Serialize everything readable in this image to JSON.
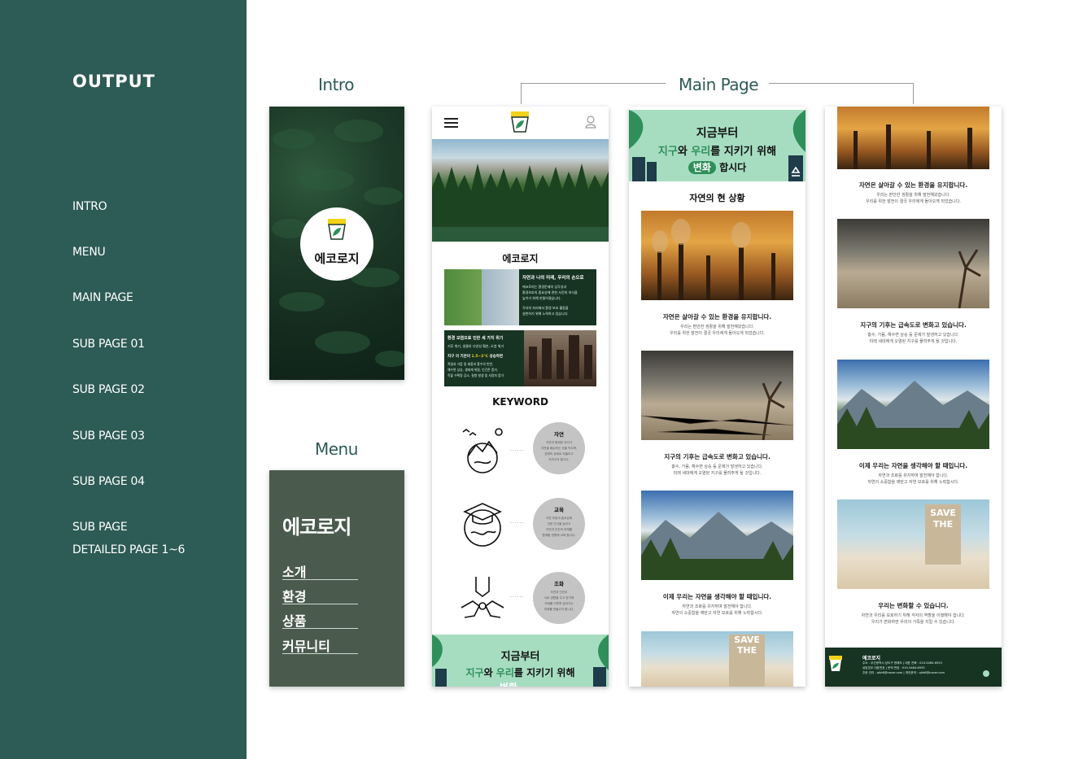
{
  "sidebar": {
    "title": "OUTPUT",
    "items": [
      "INTRO",
      "MENU",
      "MAIN PAGE",
      "SUB PAGE 01",
      "SUB PAGE 02",
      "SUB PAGE 03",
      "SUB PAGE 04"
    ],
    "last_item_line1": "SUB PAGE",
    "last_item_line2": "DETAILED PAGE 1~6"
  },
  "labels": {
    "intro": "Intro",
    "menu": "Menu",
    "main_page": "Main Page"
  },
  "intro": {
    "logo_text": "에코로지",
    "logo_mark": "에코로지"
  },
  "menu_panel": {
    "brand": "에코로지",
    "items": [
      "소개",
      "환경",
      "상품",
      "커뮤니티"
    ]
  },
  "main": {
    "logo_mark": "에코로지",
    "section_title": "에코로지",
    "card1_title": "자연과 나의 미래, 우리의 손으로",
    "card1_text1": "에코로지는 환경문제의 심각성과",
    "card1_text2": "환경보호의 중요성에 관한 사진의 의식을",
    "card1_text3": "높이기 위해 만들어졌습니다.",
    "card1_text4": "각자의 자리에서 환경 보호 활동을",
    "card1_text5": "실천하기 위해 노력하고 있습니다.",
    "card2_title": "환경 오염으로 인한 세 가지 위기",
    "card2_text1": "기후 위기, 생물의 다양성 훼손, 오염 위기",
    "card2_text2_a": "지구 의 기온이 ",
    "card2_text2_b": "1.5~2℃",
    "card2_text2_c": " 상승하면",
    "card2_text3": "폭염과 가뭄 및 태풍과 홍수의 빈번,",
    "card2_text4": "해수면 상승, 생태계 위협, 인간존 증가,",
    "card2_text5": "작물 수확량 감소, 질병 발생 및 사망자 증가",
    "keyword_title": "KEYWORD",
    "keywords": [
      {
        "title": "자연",
        "l1": "자연과 함께한 우리가",
        "l2": "자연을 훼손하는 것을 막으며,",
        "l3": "본래의 상태로 되돌리고",
        "l4": "지켜고자 합니다."
      },
      {
        "title": "교육",
        "l1": "자연 보호의 중요성에",
        "l2": "관한 인식을 높이고",
        "l3": "자연과 인간의 미래를",
        "l4": "함께할 방향에 교육 합니다."
      },
      {
        "title": "조화",
        "l1": "자연과 인간이",
        "l2": "서로 영향을 주고 받기에",
        "l3": "조화를 이루며 살아가는",
        "l4": "미래를 만들고자 합니다."
      }
    ],
    "dots": "......",
    "banner_line1": "지금부터",
    "banner_hl1": "지구",
    "banner_mid1": "와 ",
    "banner_hl2": "우리",
    "banner_rest": "를 지키기 위해",
    "banner_partial": "변화"
  },
  "page2": {
    "banner_line1": "지금부터",
    "banner_hl1": "지구",
    "banner_mid1": "와 ",
    "banner_hl2": "우리",
    "banner_rest": "를 지키기 위해",
    "banner_change": "변화",
    "banner_end": "합시다",
    "section_title": "자연의 현 상황",
    "captions": [
      {
        "title": "자연은 살아갈 수 있는 환경을 유지합니다.",
        "l1": "우리는 편안한 생활을 위해 발전해왔습니다.",
        "l2": "우리를 위한 발전이 결국 우리에게 돌아오게 되었습니다."
      },
      {
        "title": "지구의 기후는 급속도로 변화고 있습니다.",
        "l1": "홍수, 가뭄, 해수면 상승 등 문제가 발생하고 있습니다.",
        "l2": "미래 세대에게 오염된 지구를 물려주게 될 것입니다."
      },
      {
        "title": "이제 우리는 자연을 생각해야 할 때입니다.",
        "l1": "자연과 조화를 유지하며 발전해야 합니다.",
        "l2": "자연의 소중함을 깨닫고 자연 보호를 위해 노력합시다."
      }
    ],
    "sign_text1": "SAVE",
    "sign_text2": "THE"
  },
  "page3": {
    "captions": [
      {
        "title": "자연은 살아갈 수 있는 환경을 유지합니다.",
        "l1": "우리는 편안한 생활을 위해 발전해왔습니다.",
        "l2": "우리를 위한 발전이 결국 우리에게 돌아오게 되었습니다."
      },
      {
        "title": "지구의 기후는 급속도로 변화고 있습니다.",
        "l1": "홍수, 가뭄, 해수면 상승 등 문제가 발생하고 있습니다.",
        "l2": "미래 세대에게 오염된 지구를 물려주게 될 것입니다."
      },
      {
        "title": "이제 우리는 자연을 생각해야 할 때입니다.",
        "l1": "자연과 조화를 유지하며 발전해야 합니다.",
        "l2": "자연의 소중함을 깨닫고 자연 보호를 위해 노력합시다."
      },
      {
        "title": "우리는 변화할 수 있습니다.",
        "l1": "자연과 우리를 보호하기 위해 각자의 역할을 이행해야 합니다.",
        "l2": "우리가 변화하면 우리의 가족을 지킬 수 있습니다."
      }
    ],
    "sign_text1": "SAVE",
    "sign_text2": "THE",
    "footer_logo": "에코로지",
    "footer_name": "에코로지",
    "footer_l1": "주소 : 우선광역시 남도구 한레도 | 대표 전화 : 010-5484-6555",
    "footer_l2": "상담업무 대표번호 | 문의 번호 : 010-5484-6555",
    "footer_l3": "주문 관리 : qlkt6@naver.com | 개인문의 : qlkt6@naver.com"
  },
  "colors": {
    "sidebar": "#2d5b55",
    "menu_panel": "#4a5b4e",
    "banner": "#a6ddc1",
    "footer": "#173322",
    "accent_yellow": "#f3d21c",
    "accent_green": "#2f8f5a"
  }
}
